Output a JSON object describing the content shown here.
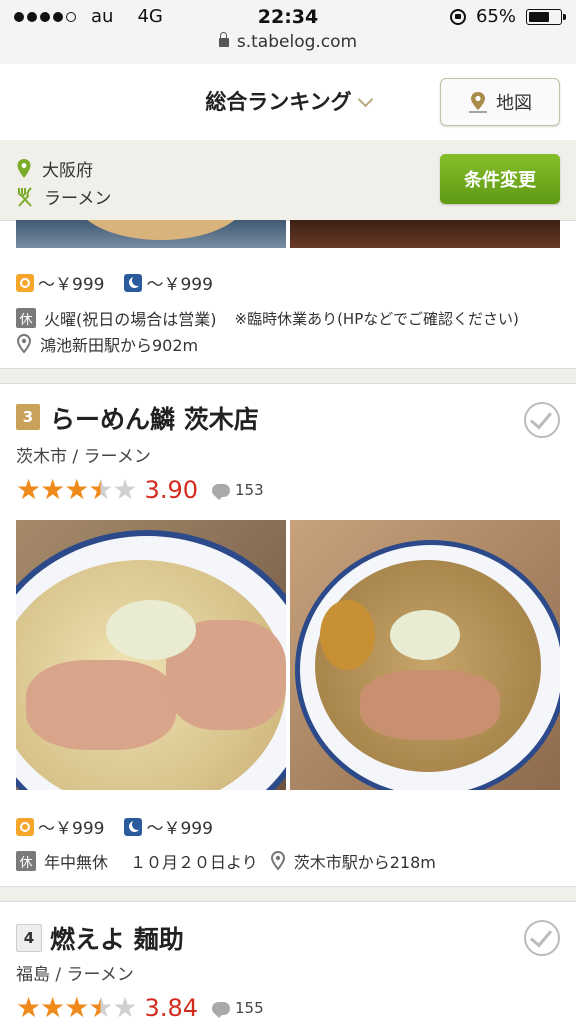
{
  "status_bar": {
    "carrier": "au",
    "network": "4G",
    "time": "22:34",
    "battery": "65%",
    "url": "s.tabelog.com"
  },
  "header": {
    "title": "総合ランキング",
    "map_button": "地図"
  },
  "conditions": {
    "area": "大阪府",
    "genre": "ラーメン",
    "change_button": "条件変更"
  },
  "prev_card": {
    "lunch_price": "～￥999",
    "dinner_price": "～￥999",
    "closed_label": "休",
    "holiday": "火曜(祝日の場合は営業)",
    "note": "※臨時休業あり(HPなどでご確認ください)",
    "access": "鴻池新田駅から902m"
  },
  "cards": [
    {
      "rank": "3",
      "name": "らーめん鱗 茨木店",
      "area": "茨木市 / ラーメン",
      "rating": 3.5,
      "score": "3.90",
      "reviews": "153",
      "lunch_price": "～￥999",
      "dinner_price": "～￥999",
      "closed_label": "休",
      "holiday": "年中無休",
      "opening": "１０月２０日より",
      "access": "茨木市駅から218m"
    },
    {
      "rank": "4",
      "name": "燃えよ 麺助",
      "area": "福島 / ラーメン",
      "rating": 3.5,
      "score": "3.84",
      "reviews": "155"
    }
  ],
  "colors": {
    "accent_green": "#6aa81b",
    "score_red": "#d32b1e",
    "star_orange": "#f08a1c",
    "rank_gold": "#c9a25a"
  }
}
